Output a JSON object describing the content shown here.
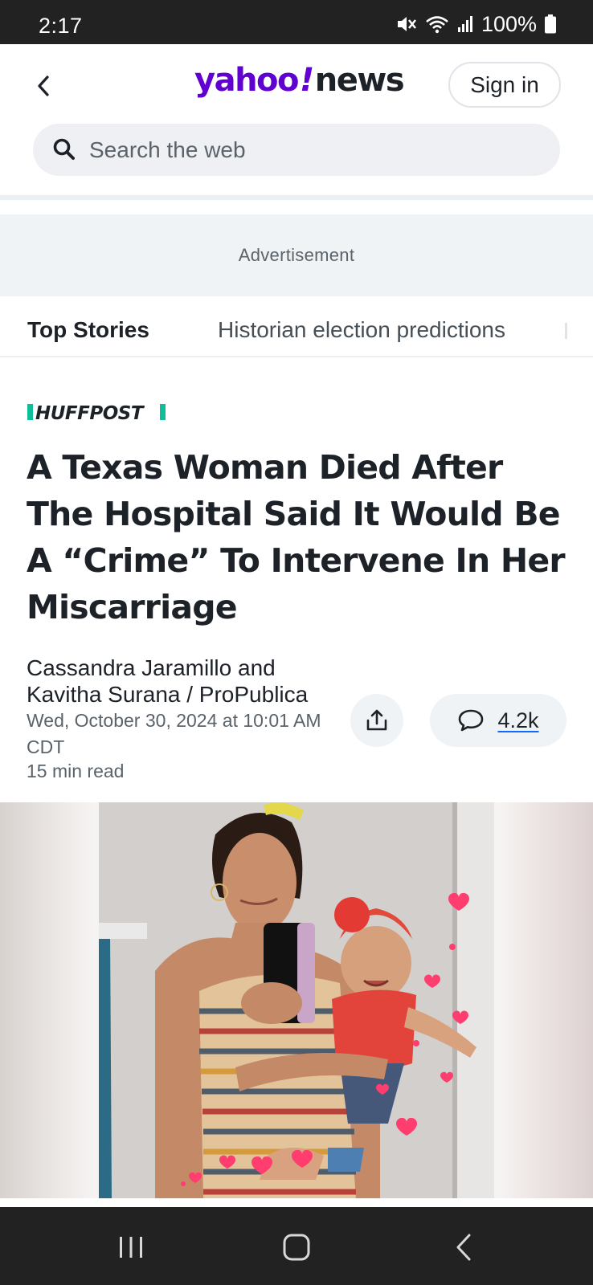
{
  "status_bar": {
    "time": "2:17",
    "battery": "100%",
    "icons": [
      "mute-icon",
      "wifi-icon",
      "signal-icon",
      "battery-icon"
    ]
  },
  "header": {
    "logo": {
      "yahoo": "yahoo",
      "slash": "/",
      "exclaim_dot": "!",
      "news": "news"
    },
    "sign_in_label": "Sign in",
    "search": {
      "placeholder": "Search the web",
      "value": ""
    }
  },
  "ad": {
    "label": "Advertisement"
  },
  "tabs": [
    {
      "label": "Top Stories",
      "selected": true
    },
    {
      "label": "Historian election predictions",
      "selected": false
    }
  ],
  "article": {
    "publisher": "HUFFPOST",
    "headline": "A Texas Woman Died After The Hospital Said It Would Be A “Crime” To Intervene In Her Miscarriage",
    "byline": "Cassandra Jaramillo and Kavitha Surana / ProPublica",
    "date": "Wed, October 30, 2024 at 10:01 AM CDT",
    "read_time": "15 min read",
    "comments_count": "4.2k"
  },
  "colors": {
    "yahoo_purple": "#6001d2",
    "huffpost_green": "#0dbe98",
    "text_primary": "#1d2228",
    "text_secondary": "#5b636a",
    "status_bar_bg": "#222222"
  }
}
